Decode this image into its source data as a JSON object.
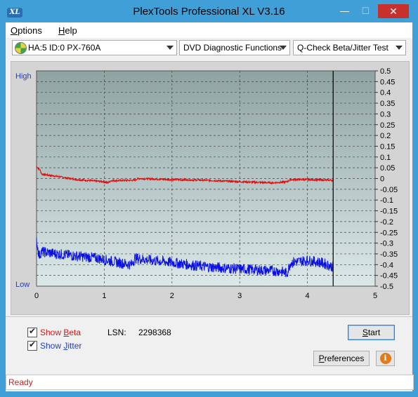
{
  "window": {
    "title": "PlexTools Professional XL V3.16",
    "app_icon": "XL"
  },
  "titlebar_buttons": {
    "minimize": "—",
    "maximize": "☐",
    "close": "✕"
  },
  "menu": {
    "options": {
      "accel": "O",
      "rest": "ptions"
    },
    "help": {
      "accel": "H",
      "rest": "elp"
    }
  },
  "toolbar": {
    "drive": "HA:5 ID:0  PX-760A",
    "function": "DVD Diagnostic Functions",
    "test": "Q-Check Beta/Jitter Test"
  },
  "plot": {
    "left_high_label": "High",
    "left_low_label": "Low",
    "x_ticks": [
      "0",
      "1",
      "2",
      "3",
      "4",
      "5"
    ],
    "y_ticks": [
      "0.5",
      "0.45",
      "0.4",
      "0.35",
      "0.3",
      "0.25",
      "0.2",
      "0.15",
      "0.1",
      "0.05",
      "0",
      "-0.05",
      "-0.1",
      "-0.15",
      "-0.2",
      "-0.25",
      "-0.3",
      "-0.35",
      "-0.4",
      "-0.45",
      "-0.5"
    ],
    "colors": {
      "beta": "#e01010",
      "jitter": "#0a10e0",
      "plot_bg_top": "#8fa3a3",
      "plot_bg_bottom": "#dbe8e8"
    }
  },
  "chart_data": {
    "type": "line",
    "x_range": [
      0,
      5
    ],
    "y_range": [
      -0.5,
      0.5
    ],
    "grid": true,
    "end_marker_x": 4.38,
    "series": [
      {
        "color": "#e01010",
        "x": [
          0,
          0.05,
          0.08,
          0.3,
          0.6,
          1.0,
          1.05,
          1.1,
          1.45,
          1.5,
          2.0,
          2.5,
          3.0,
          3.5,
          3.7,
          3.75,
          4.0,
          4.38
        ],
        "values": [
          0.055,
          0.04,
          0.02,
          0.01,
          -0.005,
          -0.015,
          -0.02,
          -0.01,
          -0.008,
          0.0,
          -0.005,
          -0.008,
          -0.015,
          -0.02,
          -0.015,
          -0.005,
          -0.005,
          -0.008
        ]
      },
      {
        "color": "#0a10e0",
        "x": [
          0,
          0.04,
          0.07,
          0.3,
          0.6,
          0.9,
          1.2,
          1.4,
          1.45,
          1.7,
          2.0,
          2.5,
          3.0,
          3.3,
          3.6,
          3.7,
          3.75,
          4.0,
          4.2,
          4.38
        ],
        "values": [
          -0.29,
          -0.36,
          -0.34,
          -0.35,
          -0.36,
          -0.37,
          -0.39,
          -0.4,
          -0.37,
          -0.38,
          -0.39,
          -0.41,
          -0.42,
          -0.425,
          -0.43,
          -0.44,
          -0.39,
          -0.38,
          -0.39,
          -0.41
        ]
      }
    ]
  },
  "controls": {
    "show_beta": {
      "accel": "B",
      "before": "Show ",
      "after": "eta",
      "color": "#d01818"
    },
    "show_jitter": {
      "accel": "J",
      "before": "Show ",
      "after": "itter",
      "color": "#1f3fc4"
    },
    "lsn_label": "LSN:",
    "lsn_value": "2298368",
    "start": {
      "accel": "S",
      "rest": "tart"
    },
    "preferences": {
      "accel": "P",
      "rest": "references"
    },
    "info_icon": "i"
  },
  "status": {
    "text": "Ready"
  }
}
